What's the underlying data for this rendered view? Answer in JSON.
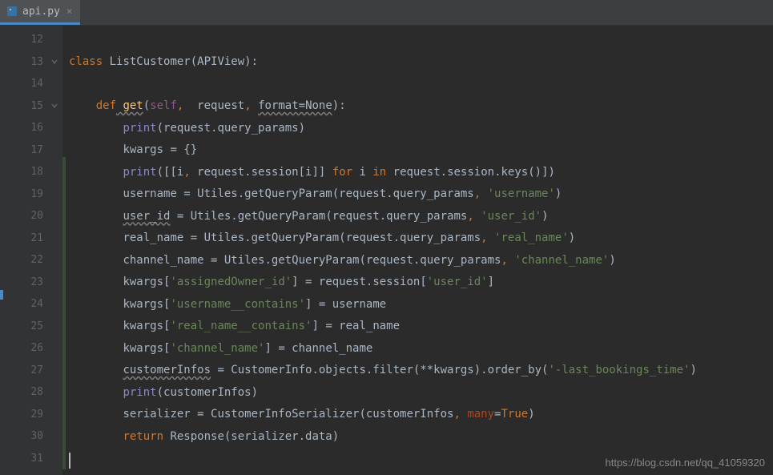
{
  "tab": {
    "filename": "api.py"
  },
  "gutter": {
    "start": 12,
    "end": 31
  },
  "code": {
    "l12": "",
    "l13": {
      "kw": "class",
      "cls": " ListCustomer(APIView):"
    },
    "l14": "",
    "l15": {
      "indent": "    ",
      "kw": "def",
      "fn": " get",
      "p1": "(",
      "self": "self",
      "c1": ",",
      "p2": "  request",
      "c2": ",",
      "sp": " ",
      "param": "format=None",
      "p3": "):"
    },
    "l16": {
      "indent": "        ",
      "builtin": "print",
      "rest": "(request.query_params)"
    },
    "l17": {
      "indent": "        ",
      "text": "kwargs = {}"
    },
    "l18": {
      "indent": "        ",
      "builtin": "print",
      "p1": "([[i",
      "c1": ",",
      "p2": " request.session[i]] ",
      "kw1": "for",
      "p3": " i ",
      "kw2": "in",
      "p4": " request.session.keys()])"
    },
    "l19": {
      "indent": "        ",
      "var": "username = Utiles.getQueryParam(request.query_params",
      "c1": ",",
      "sp": " ",
      "str": "'username'",
      "end": ")"
    },
    "l20": {
      "indent": "        ",
      "varU": "user_id",
      "rest": " = Utiles.getQueryParam(request.query_params",
      "c1": ",",
      "sp": " ",
      "str": "'user_id'",
      "end": ")"
    },
    "l21": {
      "indent": "        ",
      "var": "real_name = Utiles.getQueryParam(request.query_params",
      "c1": ",",
      "sp": " ",
      "str": "'real_name'",
      "end": ")"
    },
    "l22": {
      "indent": "        ",
      "var": "channel_name = Utiles.getQueryParam(request.query_params",
      "c1": ",",
      "sp": " ",
      "str": "'channel_name'",
      "end": ")"
    },
    "l23": {
      "indent": "        ",
      "p1": "kwargs[",
      "str1": "'assignedOwner_id'",
      "p2": "] = request.session[",
      "str2": "'user_id'",
      "p3": "]"
    },
    "l24": {
      "indent": "        ",
      "p1": "kwargs[",
      "str": "'username__contains'",
      "p2": "] = username"
    },
    "l25": {
      "indent": "        ",
      "p1": "kwargs[",
      "str": "'real_name__contains'",
      "p2": "] = real_name"
    },
    "l26": {
      "indent": "        ",
      "p1": "kwargs[",
      "str": "'channel_name'",
      "p2": "] = channel_name"
    },
    "l27": {
      "indent": "        ",
      "varU": "customerInfos",
      "rest": " = CustomerInfo.objects.filter(**kwargs).order_by(",
      "str": "'-last_bookings_time'",
      "end": ")"
    },
    "l28": {
      "indent": "        ",
      "builtin": "print",
      "rest": "(customerInfos)"
    },
    "l29": {
      "indent": "        ",
      "var": "serializer = CustomerInfoSerializer(customerInfos",
      "c1": ",",
      "sp": " ",
      "param": "many",
      "eq": "=",
      "val": "True",
      "end": ")"
    },
    "l30": {
      "indent": "        ",
      "kw": "return",
      "rest": " Response(serializer.data)"
    },
    "l31": ""
  },
  "watermark": "https://blog.csdn.net/qq_41059320"
}
